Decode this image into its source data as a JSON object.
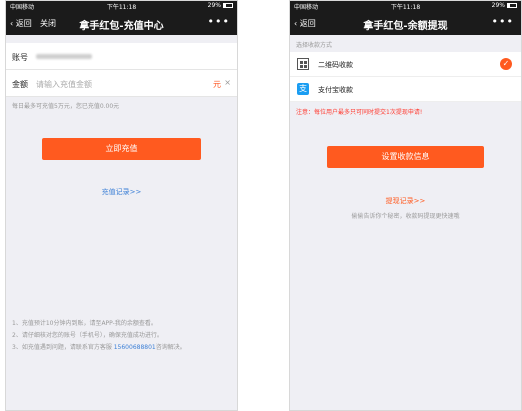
{
  "screen1": {
    "status": {
      "carrier": "中国移动",
      "time": "下午11:18",
      "battery": "29%"
    },
    "nav": {
      "back": "返回",
      "close": "关闭",
      "title": "拿手红包-充值中心",
      "more": "•••"
    },
    "account": {
      "label": "账号"
    },
    "amount": {
      "label": "金额",
      "placeholder": "请输入充值金额",
      "unit": "元",
      "clear": "×"
    },
    "hint": "每日最多可充值5万元，您已充值0.00元",
    "button": "立即充值",
    "record_link": "充值记录>>",
    "notes": {
      "line1": "1、充值预计10分钟内到账，请至APP-我的余额查看。",
      "line2": "2、请仔细核对您的账号（手机号），确保充值成功进行。",
      "line3_prefix": "3、如充值遇到问题，请联系官方客服 ",
      "line3_phone": "15600688801",
      "line3_suffix": "咨询解决。"
    }
  },
  "screen2": {
    "status": {
      "carrier": "中国移动",
      "time": "下午11:18",
      "battery": "29%"
    },
    "nav": {
      "back": "返回",
      "title": "拿手红包-余额提现",
      "more": "•••"
    },
    "section_title": "选择收款方式",
    "options": [
      {
        "label": "二维码收款",
        "icon": "qr-code-icon",
        "selected": true
      },
      {
        "label": "支付宝收款",
        "icon": "alipay-icon",
        "selected": false
      }
    ],
    "notice": "注意：每位用户最多只可同时提交1次提现申请!",
    "button": "设置收款信息",
    "record_link": "提现记录>>",
    "subtext": "偷偷告诉你个秘密，收款码提现更快速哦",
    "colors": {
      "accent": "#ff5a1f",
      "link": "#3b7fd6",
      "navbar": "#1b1b1b"
    }
  }
}
